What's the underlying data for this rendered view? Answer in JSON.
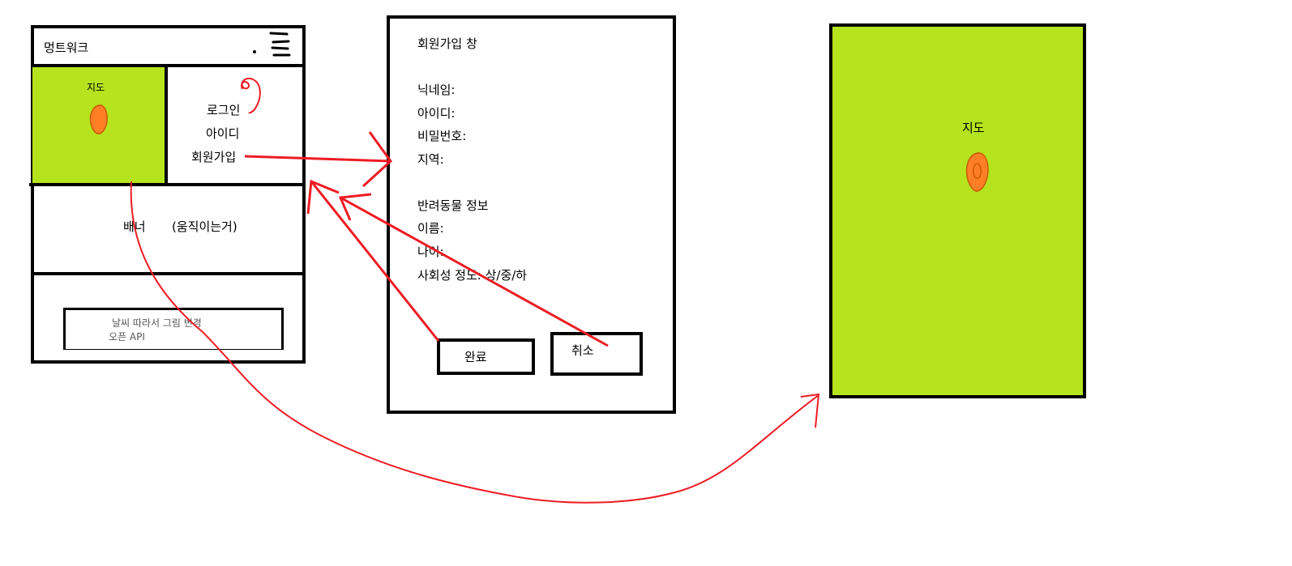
{
  "colors": {
    "line": "#000000",
    "map_fill": "#b5e31e",
    "pin_fill": "#ff7f27",
    "pin_stroke": "#c85a00",
    "arrow": "#ed1c24"
  },
  "icons": {
    "menu": "hamburger-menu-icon",
    "pin": "map-pin-icon",
    "scribble": "red-scribble-icon"
  },
  "main_screen": {
    "app_title": "멍트워크",
    "map_label": "지도",
    "auth_links": {
      "login": "로그인",
      "id": "아이디",
      "signup": "회원가입"
    },
    "banner": {
      "label": "배너",
      "note": "(움직이는거)"
    },
    "weather_box": {
      "line1": "날씨 따라서 그림 변경",
      "line2": "오픈 API"
    }
  },
  "signup_screen": {
    "title": "회원가입 창",
    "fields": [
      "닉네임:",
      "아이디:",
      "비밀번호:",
      "지역:"
    ],
    "pet_section_title": "반려동물 정보",
    "pet_fields": [
      "이름:",
      "나이:",
      "사회성 정도: 상/중/하"
    ],
    "buttons": {
      "complete": "완료",
      "cancel": "취소"
    }
  },
  "map_screen": {
    "map_label": "지도"
  }
}
